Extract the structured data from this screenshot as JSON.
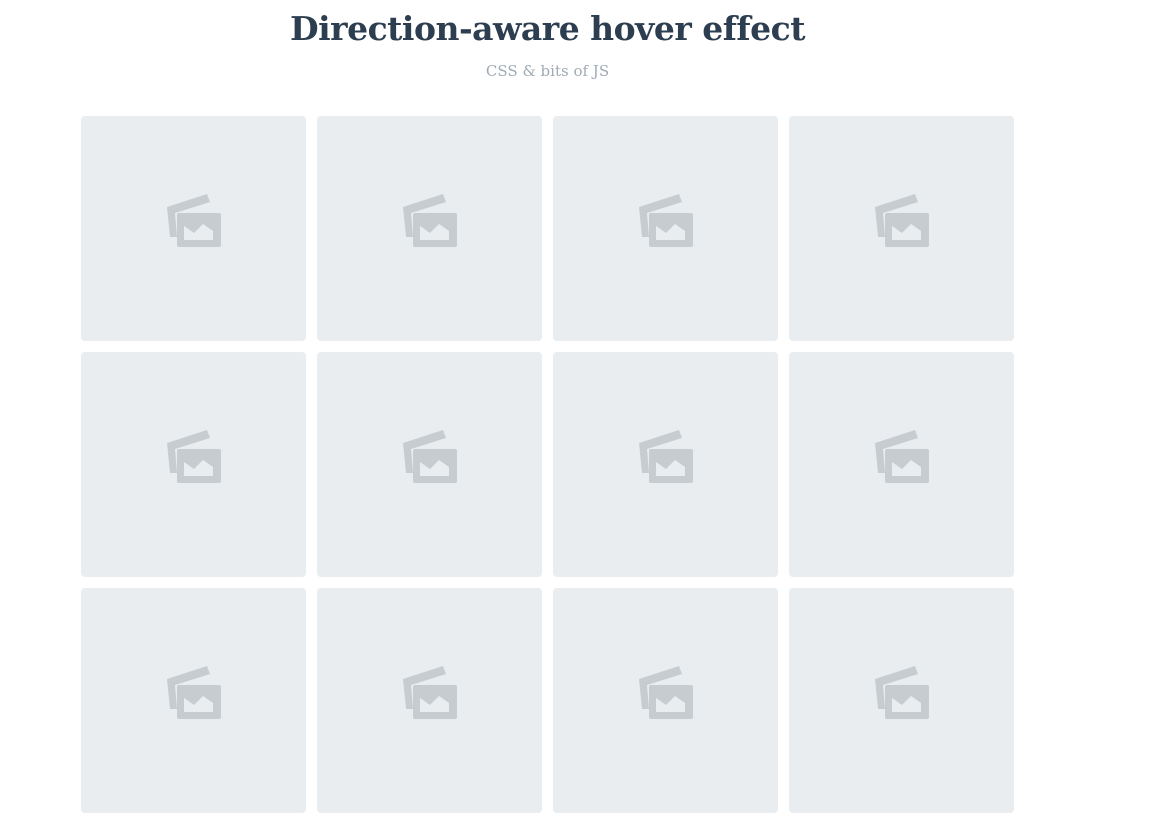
{
  "header": {
    "title": "Direction-aware hover effect",
    "subtitle": "CSS & bits of JS"
  },
  "tiles": [
    {
      "icon": "image-placeholder-icon"
    },
    {
      "icon": "image-placeholder-icon"
    },
    {
      "icon": "image-placeholder-icon"
    },
    {
      "icon": "image-placeholder-icon"
    },
    {
      "icon": "image-placeholder-icon"
    },
    {
      "icon": "image-placeholder-icon"
    },
    {
      "icon": "image-placeholder-icon"
    },
    {
      "icon": "image-placeholder-icon"
    },
    {
      "icon": "image-placeholder-icon"
    },
    {
      "icon": "image-placeholder-icon"
    },
    {
      "icon": "image-placeholder-icon"
    },
    {
      "icon": "image-placeholder-icon"
    }
  ],
  "colors": {
    "title": "#2c3e50",
    "subtitle": "#a0aab4",
    "tile_background": "#e9edef",
    "icon": "#c7ccd1"
  }
}
